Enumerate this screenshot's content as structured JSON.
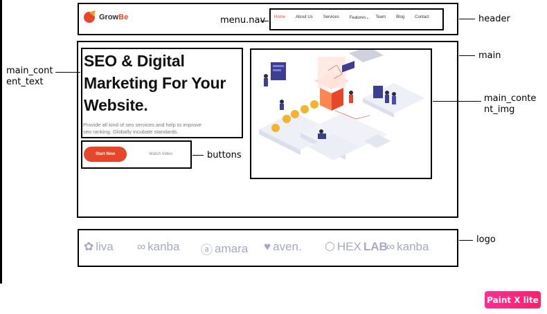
{
  "annotations": {
    "header": "header",
    "menu_nav": "menu.nav",
    "main": "main",
    "main_content_text_line1": "main_cont",
    "main_content_text_line2": "ent_text",
    "main_content_img_line1": "main_conte",
    "main_content_img_line2": "nt_img",
    "buttons": "buttons",
    "logo": "logo"
  },
  "brand": {
    "prefix": "Grow",
    "suffix": "Be"
  },
  "nav": {
    "items": [
      "Home",
      "About Us",
      "Services",
      "Features",
      "Team",
      "Blog",
      "Contact"
    ],
    "features_caret": "⌄"
  },
  "hero": {
    "title_line1": "SEO & Digital",
    "title_line2": "Marketing For Your",
    "title_line3": "Website.",
    "description_line1": "Provide all kind of seo services and help to improve",
    "description_line2": "seo ranking. Globally incubate standards."
  },
  "buttons": {
    "primary": "Start Now",
    "secondary": "Watch Video"
  },
  "logos": [
    "liva",
    "kanba",
    "amara",
    "aven.",
    "HEX",
    "LAB",
    "kanba"
  ],
  "badge": "Paint X lite",
  "colors": {
    "accent": "#e8462a",
    "logo_gray": "#a7a9c4",
    "badge": "#ff2d8f"
  }
}
